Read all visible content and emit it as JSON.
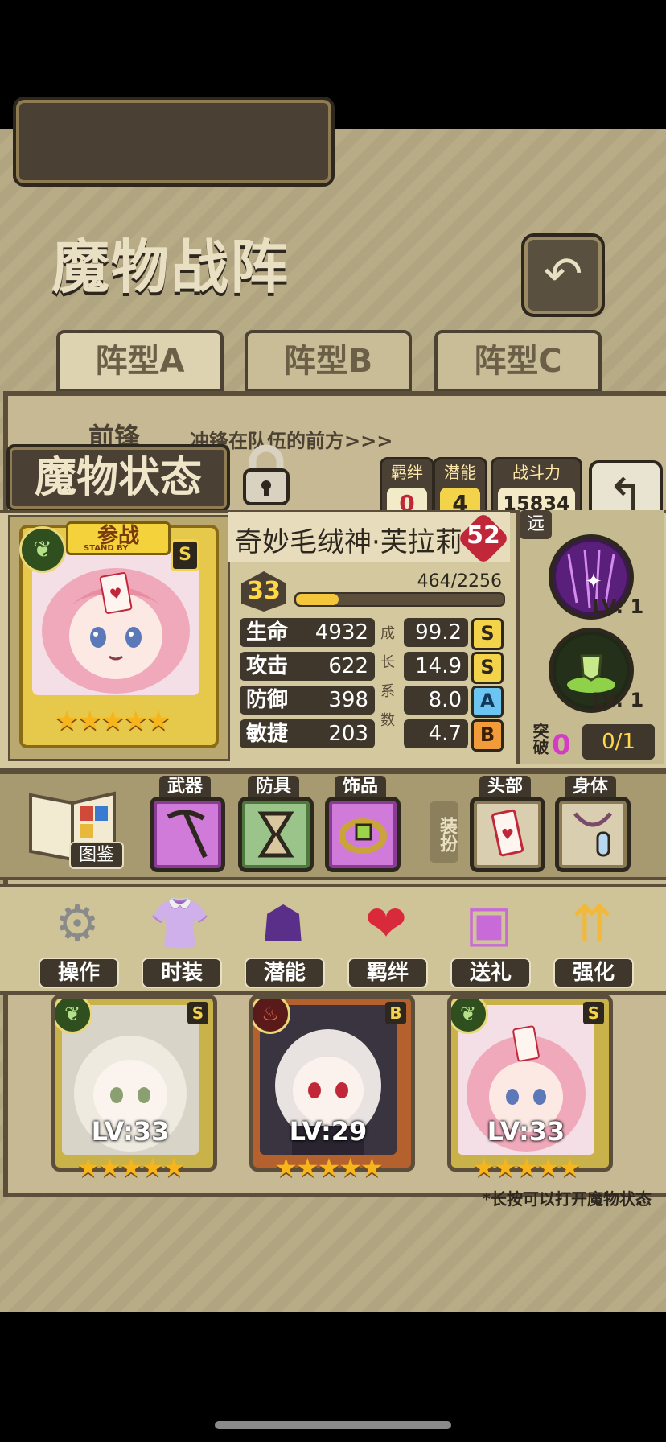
{
  "header": {
    "title": "魔物战阵",
    "back_icon": "undo-arrow-icon"
  },
  "tabs": [
    {
      "label": "阵型A",
      "active": true
    },
    {
      "label": "阵型B",
      "active": false
    },
    {
      "label": "阵型C",
      "active": false
    }
  ],
  "formation": {
    "row_label": "前锋",
    "row_desc": "冲锋在队伍的前方>>>"
  },
  "status": {
    "title": "魔物状态",
    "bond_label": "羁绊",
    "bond_value": "0",
    "potential_label": "潜能",
    "potential_value": "4",
    "power_label": "战斗力",
    "power_value": "15834"
  },
  "card": {
    "standby_label": "参战",
    "standby_sub": "STAND BY",
    "grade": "S",
    "stars": "★★★★★"
  },
  "monster": {
    "name": "奇妙毛绒神·芙拉莉",
    "heart_value": "52",
    "level": "33",
    "exp_text": "464/2256",
    "exp_fraction": 0.206,
    "growth_label": "成长系数",
    "stats": [
      {
        "name": "生命",
        "value": "4932",
        "growth": "99.2",
        "grade": "S"
      },
      {
        "name": "攻击",
        "value": "622",
        "growth": "14.9",
        "grade": "S"
      },
      {
        "name": "防御",
        "value": "398",
        "growth": "8.0",
        "grade": "A"
      },
      {
        "name": "敏捷",
        "value": "203",
        "growth": "4.7",
        "grade": "B"
      }
    ]
  },
  "side": {
    "range_label": "远",
    "skill1_lv": "LV: 1",
    "skill2_lv": "LV: 1",
    "breakthrough_label": "突破",
    "breakthrough_value": "0",
    "breakthrough_progress": "0/1"
  },
  "equipment": {
    "book_label": "图鉴",
    "weapon_label": "武器",
    "armor_label": "防具",
    "accessory_label": "饰品",
    "dress_label": "装扮",
    "head_label": "头部",
    "body_label": "身体"
  },
  "menu": [
    {
      "label": "操作",
      "icon": "gear-icon"
    },
    {
      "label": "时装",
      "icon": "dress-icon"
    },
    {
      "label": "潜能",
      "icon": "demon-icon"
    },
    {
      "label": "羁绊",
      "icon": "hearts-icon"
    },
    {
      "label": "送礼",
      "icon": "gift-icon"
    },
    {
      "label": "强化",
      "icon": "upgrade-arrows-icon"
    }
  ],
  "team": [
    {
      "level": "LV:33",
      "grade": "S",
      "stars": "★★★★★"
    },
    {
      "level": "LV:29",
      "grade": "B",
      "stars": "★★★★★"
    },
    {
      "level": "LV:33",
      "grade": "S",
      "stars": "★★★★★"
    }
  ],
  "hint": "*长按可以打开魔物状态"
}
